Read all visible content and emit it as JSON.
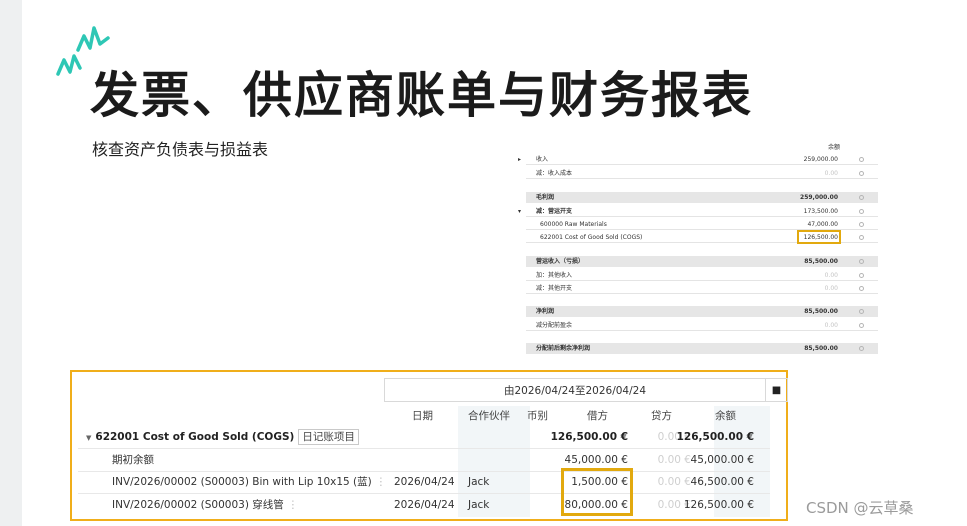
{
  "slide": {
    "title": "发票、供应商账单与财务报表",
    "subtitle": "核查资产负债表与损益表",
    "accent_color": "#2ec7b5",
    "highlight_color": "#e2a90e"
  },
  "profit_loss": {
    "column_header": "余额",
    "rows": [
      {
        "label": "收入",
        "amount": "259,000.00",
        "prefix": "▸"
      },
      {
        "label": "减：收入成本",
        "amount": "0.00",
        "faded": true
      },
      {
        "label": "毛利润",
        "amount": "259,000.00",
        "shaded": true
      },
      {
        "label": "减：营运开支",
        "amount": "173,500.00",
        "prefix": "▾",
        "bold": true
      },
      {
        "label": "600000 Raw Materials",
        "amount": "47,000.00",
        "indent": true
      },
      {
        "label": "622001 Cost of Good Sold (COGS)",
        "amount": "126,500.00",
        "indent": true,
        "highlight": true
      },
      {
        "label": "营运收入（亏损）",
        "amount": "85,500.00",
        "shaded": true
      },
      {
        "label": "加：其他收入",
        "amount": "0.00",
        "faded": true
      },
      {
        "label": "减：其他开支",
        "amount": "0.00",
        "faded": true
      },
      {
        "label": "净利润",
        "amount": "85,500.00",
        "shaded": true
      },
      {
        "label": "减分配前盈余",
        "amount": "0.00",
        "faded": true
      },
      {
        "label": "分配前后剩余净利润",
        "amount": "85,500.00",
        "shaded": true
      }
    ]
  },
  "ledger": {
    "date_range": "由2026/04/24至2026/04/24",
    "trash_icon": "trash-icon",
    "columns": {
      "date": "日期",
      "partner": "合作伙伴",
      "currency": "币别",
      "debit": "借方",
      "credit": "贷方",
      "balance": "余额"
    },
    "account": {
      "name": "622001 Cost of Good Sold (COGS)",
      "badge": "日记账项目",
      "debit": "126,500.00 €",
      "credit": "0.00 €",
      "balance": "126,500.00 €"
    },
    "rows": [
      {
        "label": "期初余额",
        "date": "",
        "partner": "",
        "debit": "45,000.00 €",
        "credit": "0.00 €",
        "balance": "45,000.00 €"
      },
      {
        "label": "INV/2026/00002 (S00003) Bin with Lip 10x15 (蓝)",
        "date": "2026/04/24",
        "partner": "Jack",
        "debit": "1,500.00 €",
        "credit": "0.00 €",
        "balance": "46,500.00 €"
      },
      {
        "label": "INV/2026/00002 (S00003) 穿线管",
        "date": "2026/04/24",
        "partner": "Jack",
        "debit": "80,000.00 €",
        "credit": "0.00 €",
        "balance": "126,500.00 €"
      }
    ]
  },
  "watermark": "CSDN @云草桑"
}
